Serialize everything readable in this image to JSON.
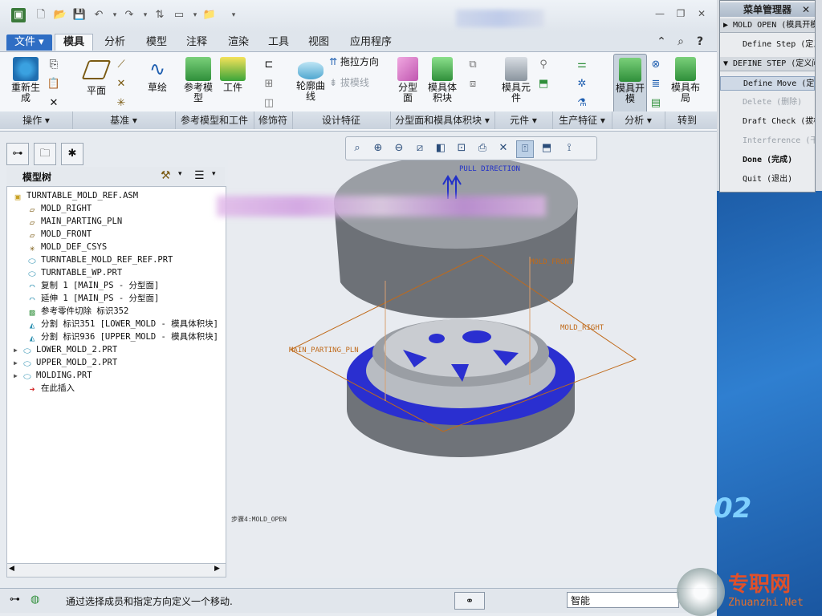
{
  "qat": {
    "icons": [
      "app-icon",
      "new-icon",
      "open-icon",
      "save-icon",
      "undo-icon",
      "redo-icon",
      "regenerate-icon",
      "windows-icon",
      "folder-icon",
      "more-icon"
    ]
  },
  "tabs": [
    "文件",
    "模具",
    "分析",
    "模型",
    "注释",
    "渲染",
    "工具",
    "视图",
    "应用程序"
  ],
  "ribbon": {
    "regen": "重新生成",
    "plane": "平面",
    "sketch": "草绘",
    "ref_model": "参考模型",
    "workpiece": "工件",
    "outline_curve": "轮廓曲线",
    "pull_direction": "拖拉方向",
    "draft_line": "拔模线",
    "parting_surface": "分型面",
    "mold_volume": "模具体积块",
    "mold_component": "模具元件",
    "mold_open": "模具开模",
    "mold_layout": "模具布局"
  },
  "groups": [
    "操作",
    "基准",
    "参考模型和工件",
    "修饰符",
    "设计特征",
    "分型面和模具体积块",
    "元件",
    "生产特征",
    "分析",
    "转到"
  ],
  "tree": {
    "title": "模型树",
    "nodes": [
      {
        "label": "TURNTABLE_MOLD_REF.ASM",
        "icon": "assembly-icon",
        "indent": 0,
        "expand": ""
      },
      {
        "label": "MOLD_RIGHT",
        "icon": "datum-plane-icon",
        "indent": 1,
        "expand": ""
      },
      {
        "label": "MAIN_PARTING_PLN",
        "icon": "datum-plane-icon",
        "indent": 1,
        "expand": ""
      },
      {
        "label": "MOLD_FRONT",
        "icon": "datum-plane-icon",
        "indent": 1,
        "expand": ""
      },
      {
        "label": "MOLD_DEF_CSYS",
        "icon": "csys-icon",
        "indent": 1,
        "expand": ""
      },
      {
        "label": "TURNTABLE_MOLD_REF_REF.PRT",
        "icon": "part-icon",
        "indent": 1,
        "expand": ""
      },
      {
        "label": "TURNTABLE_WP.PRT",
        "icon": "part-icon",
        "indent": 1,
        "expand": ""
      },
      {
        "label": "复制 1 [MAIN_PS - 分型面]",
        "icon": "surface-icon",
        "indent": 1,
        "expand": ""
      },
      {
        "label": "延伸 1 [MAIN_PS - 分型面]",
        "icon": "surface-icon",
        "indent": 1,
        "expand": ""
      },
      {
        "label": "参考零件切除 标识352",
        "icon": "cut-icon",
        "indent": 1,
        "expand": ""
      },
      {
        "label": "分割 标识351 [LOWER_MOLD - 模具体积块]",
        "icon": "split-icon",
        "indent": 1,
        "expand": ""
      },
      {
        "label": "分割 标识936 [UPPER_MOLD - 模具体积块]",
        "icon": "split-icon",
        "indent": 1,
        "expand": ""
      },
      {
        "label": "LOWER_MOLD_2.PRT",
        "icon": "part-icon",
        "indent": 0,
        "expand": "▶"
      },
      {
        "label": "UPPER_MOLD_2.PRT",
        "icon": "part-icon",
        "indent": 0,
        "expand": "▶"
      },
      {
        "label": "MOLDING.PRT",
        "icon": "part-icon",
        "indent": 0,
        "expand": "▶"
      },
      {
        "label": "在此插入",
        "icon": "insert-here-icon",
        "indent": 1,
        "expand": ""
      }
    ]
  },
  "viewport": {
    "pull_direction": "PULL DIRECTION",
    "mold_front": "MOLD_FRONT",
    "mold_right": "MOLD_RIGHT",
    "main_parting": "MAIN_PARTING_PLN",
    "step_label": "步骤4:MOLD_OPEN"
  },
  "status": {
    "message": "通过选择成员和指定方向定义一个移动.",
    "filter": "智能"
  },
  "menu_manager": {
    "title": "菜单管理器",
    "items": [
      {
        "label": "▶ MOLD OPEN (模具开模)",
        "kind": "hdr"
      },
      {
        "label": "Define Step (定义间距)",
        "kind": "normal"
      },
      {
        "label": "▼ DEFINE STEP (定义间距)",
        "kind": "hdr"
      },
      {
        "label": "Define Move (定义移动)",
        "kind": "sel"
      },
      {
        "label": "Delete (删除)",
        "kind": "dis"
      },
      {
        "label": "Draft Check (拔模检测)",
        "kind": "normal"
      },
      {
        "label": "Interference (干涉)",
        "kind": "dis"
      },
      {
        "label": "Done (完成)",
        "kind": "bold"
      },
      {
        "label": "Quit (退出)",
        "kind": "normal"
      }
    ]
  },
  "watermark": {
    "brand": "专职网",
    "site": "Zhuanzhi.Net",
    "frag": "02"
  },
  "colors": {
    "file_tab": "#2f6ec4",
    "mold_grey": "#8c9096",
    "parting_blue": "#2026c8",
    "plane_orange": "#c06a1a"
  }
}
